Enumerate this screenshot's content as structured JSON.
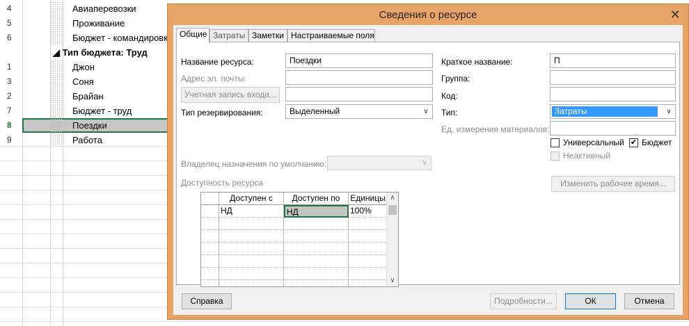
{
  "sheet": {
    "rows": [
      {
        "num": "4",
        "name": "Авиаперевозки",
        "group": false
      },
      {
        "num": "5",
        "name": "Проживание",
        "group": false
      },
      {
        "num": "6",
        "name": "Бюджет - командировк",
        "group": false
      },
      {
        "num": "",
        "name": "◢ Тип бюджета: Труд",
        "group": true
      },
      {
        "num": "1",
        "name": "Джон",
        "group": false
      },
      {
        "num": "3",
        "name": "Соня",
        "group": false
      },
      {
        "num": "2",
        "name": "Брайан",
        "group": false
      },
      {
        "num": "7",
        "name": "Бюджет - труд",
        "group": false
      },
      {
        "num": "8",
        "name": "Поездки",
        "group": false,
        "selected": true
      },
      {
        "num": "9",
        "name": "Работа",
        "group": false
      }
    ]
  },
  "dialog": {
    "title": "Сведения о ресурсе",
    "close": "✕",
    "tabs": [
      "Общие",
      "Затраты",
      "Заметки",
      "Настраиваемые поля"
    ],
    "fields": {
      "resource_name_label": "Название ресурса:",
      "resource_name_value": "Поездки",
      "email_label": "Адрес эл. почты:",
      "email_value": "",
      "logon_button": "Учетная запись входа...",
      "logon_value": "",
      "booking_type_label": "Тип резервирования:",
      "booking_type_value": "Выделенный",
      "default_owner_label": "Владелец назначения по умолчанию:",
      "default_owner_value": "",
      "initials_label": "Краткое название:",
      "initials_value": "П",
      "group_label": "Группа:",
      "group_value": "",
      "code_label": "Код:",
      "code_value": "",
      "type_label": "Тип:",
      "type_value": "Затраты",
      "material_label": "Ед. измерения материалов:",
      "material_value": ""
    },
    "checkboxes": {
      "generic_label": "Универсальный",
      "generic_checked": false,
      "budget_label": "Бюджет",
      "budget_checked": true,
      "inactive_label": "Неактивный",
      "inactive_checked": false
    },
    "availability": {
      "section_label": "Доступность ресурса",
      "columns": [
        "Доступен с",
        "Доступен по",
        "Единицы"
      ],
      "rows": [
        [
          "НД",
          "НД",
          "100%"
        ]
      ]
    },
    "change_working_time": "Изменить рабочее время...",
    "buttons": {
      "help": "Справка",
      "details": "Подробности...",
      "ok": "ОК",
      "cancel": "Отмена"
    }
  },
  "colors": {
    "dialog_frame": "#e8a466",
    "selection_green": "#217346",
    "highlight": "#3399ff"
  }
}
